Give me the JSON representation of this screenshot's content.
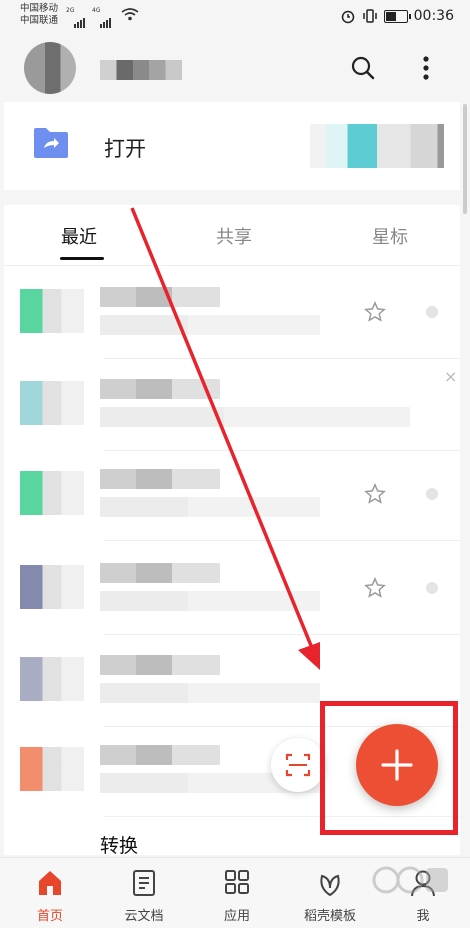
{
  "status_bar": {
    "carrier_1": "中国移动",
    "carrier_2": "中国联通",
    "net_1": "2G",
    "net_2": "4G",
    "time": "00:36",
    "battery_level": 0.6
  },
  "open_card": {
    "label": "打开"
  },
  "tabs": [
    {
      "label": "最近"
    },
    {
      "label": "共享"
    },
    {
      "label": "星标"
    }
  ],
  "list": {
    "rows": [
      {
        "title": "",
        "thumb_color": "#3ccf8e"
      },
      {
        "title": "",
        "thumb_color": "#8fd0d4"
      },
      {
        "title": "",
        "thumb_color": "#3ccf8e"
      },
      {
        "title": "",
        "thumb_color": "#6e75a0"
      },
      {
        "title": "",
        "thumb_color": "#9a9fba"
      },
      {
        "title": "",
        "thumb_color": "#f07a55"
      },
      {
        "title": "转换",
        "thumb_color": "#3f86ef"
      }
    ]
  },
  "bottom_nav": [
    {
      "label": "首页",
      "icon": "home-icon"
    },
    {
      "label": "云文档",
      "icon": "document-icon"
    },
    {
      "label": "应用",
      "icon": "apps-grid-icon"
    },
    {
      "label": "稻壳模板",
      "icon": "leaf-icon"
    },
    {
      "label": "我",
      "icon": "person-icon"
    }
  ],
  "colors": {
    "accent": "#e8462a",
    "fab": "#ec4f33",
    "annotation_red": "#e8232c"
  }
}
